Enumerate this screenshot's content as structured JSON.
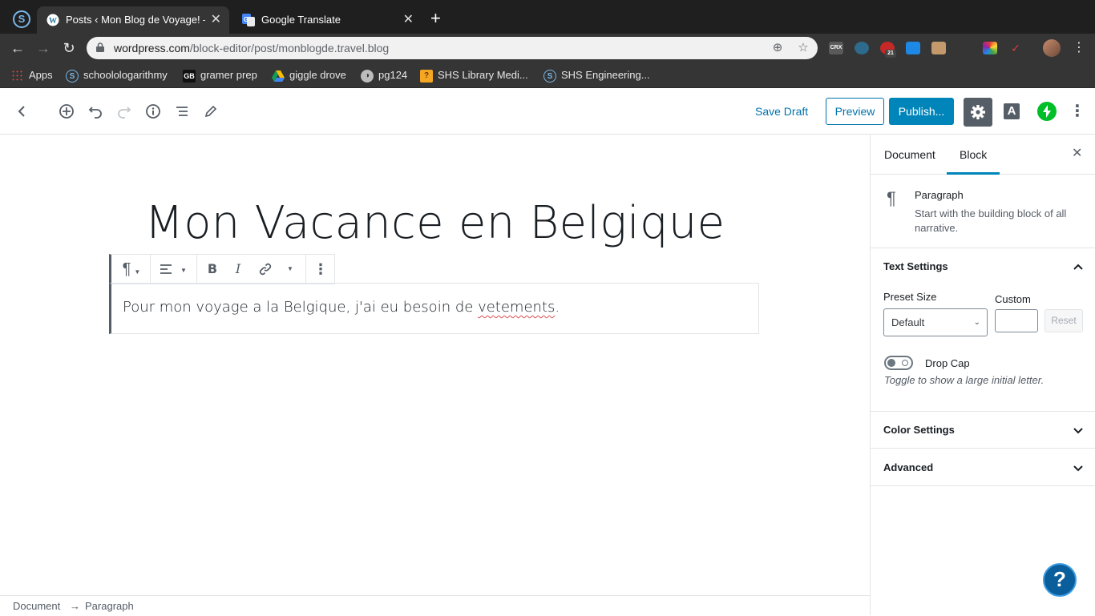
{
  "browser": {
    "tabs": [
      {
        "title": "Posts ‹ Mon Blog de Voyage! — WordPress.com",
        "active": true
      },
      {
        "title": "Google Translate",
        "active": false
      }
    ],
    "url_main": "wordpress.com",
    "url_rest": "/block-editor/post/monblogde.travel.blog",
    "bookmarks": [
      "Apps",
      "schoolologarithmy",
      "gramer prep",
      "giggle drove",
      "pg124",
      "SHS Library Medi...",
      "SHS Engineering..."
    ],
    "extensions": [
      "CRX",
      "21"
    ]
  },
  "editor_header": {
    "save_draft": "Save Draft",
    "preview": "Preview",
    "publish": "Publish...",
    "a_label": "A"
  },
  "post": {
    "title": "Mon Vacance en Belgique",
    "paragraph_before": "Pour mon voyage a la Belgique, j'ai eu besoin de ",
    "paragraph_misspelled": "vetements",
    "paragraph_after": "."
  },
  "footer": {
    "crumb_document": "Document",
    "crumb_arrow": "→",
    "crumb_paragraph": "Paragraph"
  },
  "sidebar": {
    "tab_document": "Document",
    "tab_block": "Block",
    "active_tab": "Block",
    "block_name": "Paragraph",
    "block_description": "Start with the building block of all narrative.",
    "text_settings": {
      "title": "Text Settings",
      "preset_label": "Preset Size",
      "preset_value": "Default",
      "custom_label": "Custom",
      "custom_value": "",
      "reset": "Reset",
      "drop_cap_label": "Drop Cap",
      "drop_cap_on": false,
      "drop_cap_help": "Toggle to show a large initial letter."
    },
    "color_settings": "Color Settings",
    "advanced": "Advanced"
  },
  "colors": {
    "accent": "#0085ba",
    "link": "#0073aa",
    "jetpack": "#00be28"
  }
}
